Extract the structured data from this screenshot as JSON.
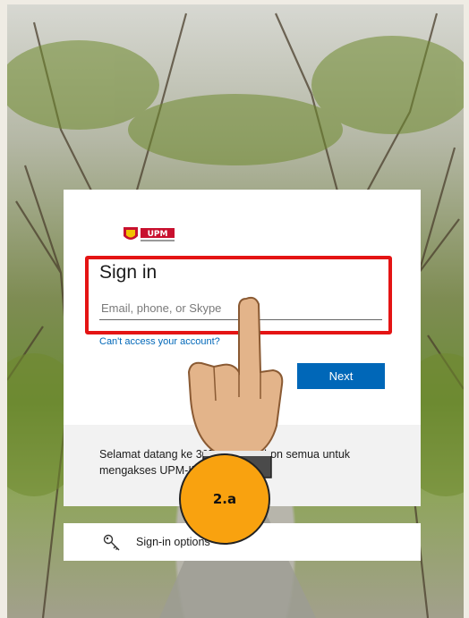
{
  "org": {
    "logo_text": "UPM"
  },
  "signin": {
    "title": "Sign in",
    "email_placeholder": "Email, phone, or Skype",
    "cant_access": "Can't access your account?",
    "next_label": "Next"
  },
  "welcome": {
    "text": "Selamat datang ke 365 UPM! Mohon semua untuk mengakses UPM-ID"
  },
  "sign_in_options": {
    "label": "Sign-in options",
    "icon": "key-icon"
  },
  "annotation": {
    "step_label": "2.a",
    "highlight_color": "#e41414",
    "badge_color": "#f9a20f"
  },
  "colors": {
    "accent": "#0067b8"
  }
}
